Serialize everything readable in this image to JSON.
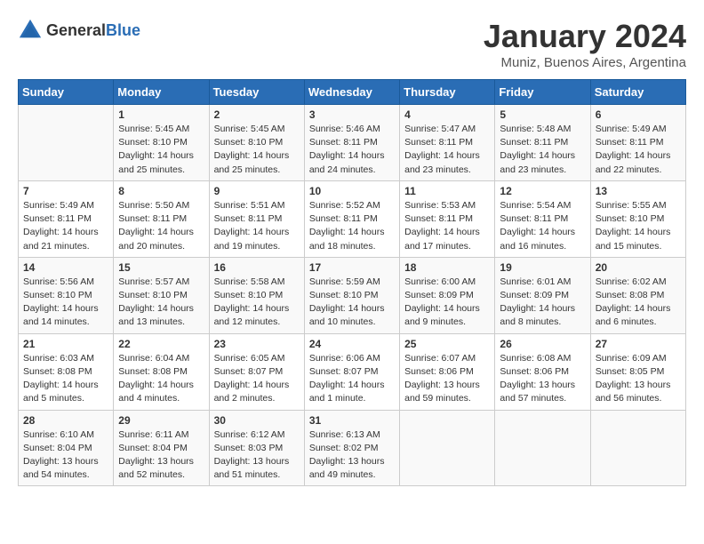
{
  "header": {
    "logo_general": "General",
    "logo_blue": "Blue",
    "month_year": "January 2024",
    "location": "Muniz, Buenos Aires, Argentina"
  },
  "days_of_week": [
    "Sunday",
    "Monday",
    "Tuesday",
    "Wednesday",
    "Thursday",
    "Friday",
    "Saturday"
  ],
  "weeks": [
    [
      {
        "day": "",
        "info": ""
      },
      {
        "day": "1",
        "info": "Sunrise: 5:45 AM\nSunset: 8:10 PM\nDaylight: 14 hours\nand 25 minutes."
      },
      {
        "day": "2",
        "info": "Sunrise: 5:45 AM\nSunset: 8:10 PM\nDaylight: 14 hours\nand 25 minutes."
      },
      {
        "day": "3",
        "info": "Sunrise: 5:46 AM\nSunset: 8:11 PM\nDaylight: 14 hours\nand 24 minutes."
      },
      {
        "day": "4",
        "info": "Sunrise: 5:47 AM\nSunset: 8:11 PM\nDaylight: 14 hours\nand 23 minutes."
      },
      {
        "day": "5",
        "info": "Sunrise: 5:48 AM\nSunset: 8:11 PM\nDaylight: 14 hours\nand 23 minutes."
      },
      {
        "day": "6",
        "info": "Sunrise: 5:49 AM\nSunset: 8:11 PM\nDaylight: 14 hours\nand 22 minutes."
      }
    ],
    [
      {
        "day": "7",
        "info": "Sunrise: 5:49 AM\nSunset: 8:11 PM\nDaylight: 14 hours\nand 21 minutes."
      },
      {
        "day": "8",
        "info": "Sunrise: 5:50 AM\nSunset: 8:11 PM\nDaylight: 14 hours\nand 20 minutes."
      },
      {
        "day": "9",
        "info": "Sunrise: 5:51 AM\nSunset: 8:11 PM\nDaylight: 14 hours\nand 19 minutes."
      },
      {
        "day": "10",
        "info": "Sunrise: 5:52 AM\nSunset: 8:11 PM\nDaylight: 14 hours\nand 18 minutes."
      },
      {
        "day": "11",
        "info": "Sunrise: 5:53 AM\nSunset: 8:11 PM\nDaylight: 14 hours\nand 17 minutes."
      },
      {
        "day": "12",
        "info": "Sunrise: 5:54 AM\nSunset: 8:11 PM\nDaylight: 14 hours\nand 16 minutes."
      },
      {
        "day": "13",
        "info": "Sunrise: 5:55 AM\nSunset: 8:10 PM\nDaylight: 14 hours\nand 15 minutes."
      }
    ],
    [
      {
        "day": "14",
        "info": "Sunrise: 5:56 AM\nSunset: 8:10 PM\nDaylight: 14 hours\nand 14 minutes."
      },
      {
        "day": "15",
        "info": "Sunrise: 5:57 AM\nSunset: 8:10 PM\nDaylight: 14 hours\nand 13 minutes."
      },
      {
        "day": "16",
        "info": "Sunrise: 5:58 AM\nSunset: 8:10 PM\nDaylight: 14 hours\nand 12 minutes."
      },
      {
        "day": "17",
        "info": "Sunrise: 5:59 AM\nSunset: 8:10 PM\nDaylight: 14 hours\nand 10 minutes."
      },
      {
        "day": "18",
        "info": "Sunrise: 6:00 AM\nSunset: 8:09 PM\nDaylight: 14 hours\nand 9 minutes."
      },
      {
        "day": "19",
        "info": "Sunrise: 6:01 AM\nSunset: 8:09 PM\nDaylight: 14 hours\nand 8 minutes."
      },
      {
        "day": "20",
        "info": "Sunrise: 6:02 AM\nSunset: 8:08 PM\nDaylight: 14 hours\nand 6 minutes."
      }
    ],
    [
      {
        "day": "21",
        "info": "Sunrise: 6:03 AM\nSunset: 8:08 PM\nDaylight: 14 hours\nand 5 minutes."
      },
      {
        "day": "22",
        "info": "Sunrise: 6:04 AM\nSunset: 8:08 PM\nDaylight: 14 hours\nand 4 minutes."
      },
      {
        "day": "23",
        "info": "Sunrise: 6:05 AM\nSunset: 8:07 PM\nDaylight: 14 hours\nand 2 minutes."
      },
      {
        "day": "24",
        "info": "Sunrise: 6:06 AM\nSunset: 8:07 PM\nDaylight: 14 hours\nand 1 minute."
      },
      {
        "day": "25",
        "info": "Sunrise: 6:07 AM\nSunset: 8:06 PM\nDaylight: 13 hours\nand 59 minutes."
      },
      {
        "day": "26",
        "info": "Sunrise: 6:08 AM\nSunset: 8:06 PM\nDaylight: 13 hours\nand 57 minutes."
      },
      {
        "day": "27",
        "info": "Sunrise: 6:09 AM\nSunset: 8:05 PM\nDaylight: 13 hours\nand 56 minutes."
      }
    ],
    [
      {
        "day": "28",
        "info": "Sunrise: 6:10 AM\nSunset: 8:04 PM\nDaylight: 13 hours\nand 54 minutes."
      },
      {
        "day": "29",
        "info": "Sunrise: 6:11 AM\nSunset: 8:04 PM\nDaylight: 13 hours\nand 52 minutes."
      },
      {
        "day": "30",
        "info": "Sunrise: 6:12 AM\nSunset: 8:03 PM\nDaylight: 13 hours\nand 51 minutes."
      },
      {
        "day": "31",
        "info": "Sunrise: 6:13 AM\nSunset: 8:02 PM\nDaylight: 13 hours\nand 49 minutes."
      },
      {
        "day": "",
        "info": ""
      },
      {
        "day": "",
        "info": ""
      },
      {
        "day": "",
        "info": ""
      }
    ]
  ]
}
